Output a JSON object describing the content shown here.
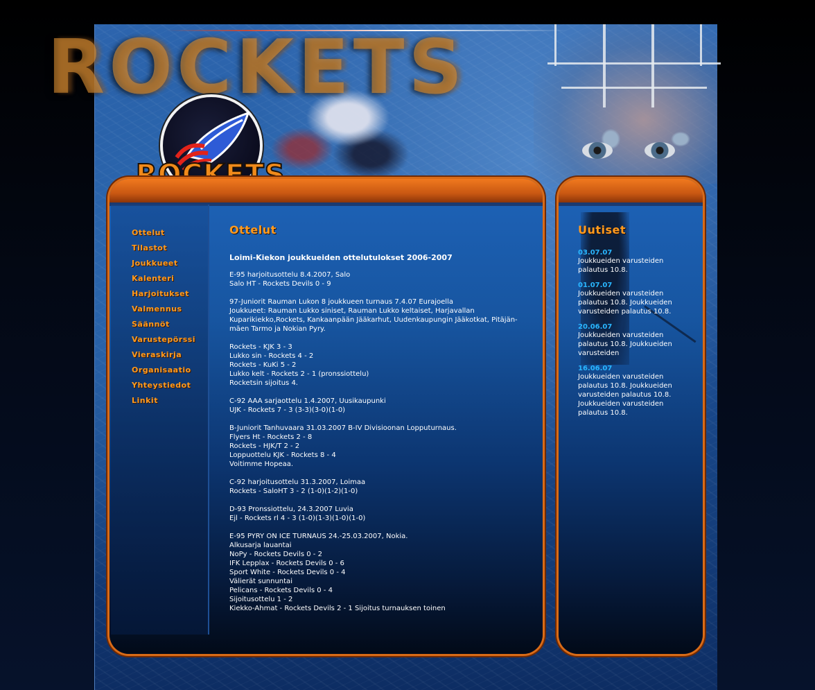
{
  "header": {
    "banner_title": "ROCKETS",
    "logo_text": "ROCKETS"
  },
  "nav": {
    "items": [
      {
        "label": "Ottelut"
      },
      {
        "label": "Tilastot"
      },
      {
        "label": "Joukkueet"
      },
      {
        "label": "Kalenteri"
      },
      {
        "label": "Harjoitukset"
      },
      {
        "label": "Valmennus"
      },
      {
        "label": "Säännöt"
      },
      {
        "label": "Varusteporssi",
        "display": "Varusteрörssi"
      },
      {
        "label": "Vieraskirja"
      },
      {
        "label": "Organisaatio"
      },
      {
        "label": "Yhteystiedot"
      },
      {
        "label": "Linkit"
      }
    ]
  },
  "main": {
    "title": "Ottelut",
    "subtitle": "Loimi-Kiekon joukkueiden ottelutulokset 2006-2007",
    "blocks": [
      "E-95 harjoitusottelu 8.4.2007, Salo\nSalo HT - Rockets Devils 0 - 9",
      "97-Juniorit Rauman Lukon 8 joukkueen turnaus 7.4.07 Eurajoella\nJoukkueet: Rauman Lukko siniset, Rauman Lukko keltaiset, Harjavallan Kuparikiekko,Rockets, Kankaanpään Jääkarhut, Uudenkaupungin Jääkotkat, Pitäjän-mäen Tarmo ja Nokian Pyry.",
      "Rockets - KJK 3 - 3\nLukko sin - Rockets 4 - 2\nRockets - KuKi 5 - 2\nLukko kelt - Rockets 2 - 1 (pronssiottelu)\nRocketsin sijoitus 4.",
      "C-92 AAA sarjaottelu 1.4.2007, Uusikaupunki\nUJK - Rockets 7 - 3 (3-3)(3-0)(1-0)",
      "B-Juniorit Tanhuvaara 31.03.2007 B-IV Divisioonan Lopputurnaus.\nFlyers Ht - Rockets 2 - 8\nRockets - HJK/T 2 - 2\nLoppuottelu KJK - Rockets 8 - 4\nVoitimme Hopeaa.",
      "C-92 harjoitusottelu 31.3.2007, Loimaa\nRockets - SaloHT 3 - 2 (1-0)(1-2)(1-0)",
      "D-93 Pronssiottelu, 24.3.2007 Luvia\nEjl - Rockets rl  4 - 3 (1-0)(1-3)(1-0)(1-0)",
      "E-95 PYRY ON ICE TURNAUS 24.-25.03.2007, Nokia.\nAlkusarja lauantai\nNoPy - Rockets Devils 0 - 2\nIFK Lepplax - Rockets Devils 0 - 6\nSport White -  Rockets Devils 0 - 4\nVälierät sunnuntai\nPelicans - Rockets Devils 0 - 4\nSijoitusottelu 1 - 2\nKiekko-Ahmat - Rockets Devils    2 - 1  Sijoitus turnauksen toinen"
    ]
  },
  "news": {
    "title": "Uutiset",
    "items": [
      {
        "date": "03.07.07",
        "text": "Joukkueiden varusteiden palautus 10.8."
      },
      {
        "date": "01.07.07",
        "text": "Joukkueiden varusteiden palautus 10.8. Joukkueiden varusteiden palautus 10.8."
      },
      {
        "date": "20.06.07",
        "text": "Joukkueiden varusteiden palautus 10.8. Joukkueiden varusteiden"
      },
      {
        "date": "16.06.07",
        "text": "Joukkueiden varusteiden palautus 10.8. Joukkueiden varusteiden palautus 10.8. Joukkueiden varusteiden palautus 10.8."
      }
    ]
  },
  "colors": {
    "accent_orange": "#ff9b1f",
    "date_blue": "#29b6ff",
    "panel_border": "#d96b17"
  }
}
